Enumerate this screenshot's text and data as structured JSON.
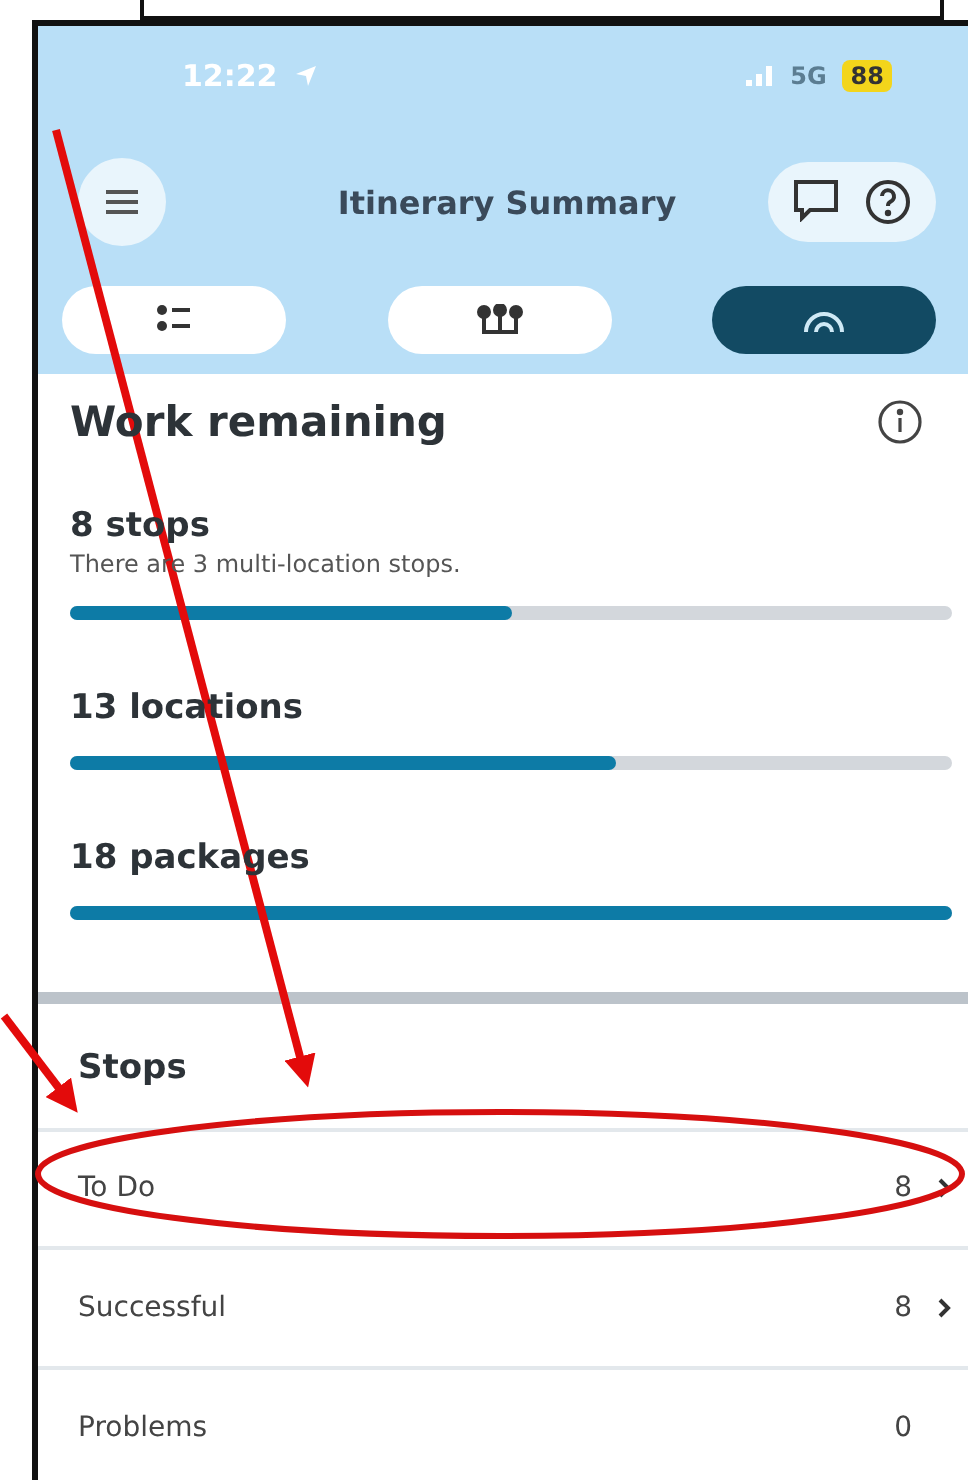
{
  "status_bar": {
    "time": "12:22",
    "network": "5G",
    "battery": "88"
  },
  "header": {
    "title": "Itinerary Summary"
  },
  "tabs": [
    {
      "kind": "list",
      "selected": false
    },
    {
      "kind": "route",
      "selected": false
    },
    {
      "kind": "gauge",
      "selected": true
    }
  ],
  "work_remaining": {
    "title": "Work remaining",
    "metrics": [
      {
        "label": "8 stops",
        "note": "There are 3 multi-location stops.",
        "level": 0.5
      },
      {
        "label": "13 locations",
        "level": 0.62
      },
      {
        "label": "18 packages",
        "level": 1
      }
    ]
  },
  "stops": {
    "title": "Stops",
    "rows": [
      {
        "label": "To Do",
        "count": "8",
        "chevron": true
      },
      {
        "label": "Successful",
        "count": "8",
        "chevron": true
      },
      {
        "label": "Problems",
        "count": "0",
        "chevron": false
      }
    ]
  }
}
